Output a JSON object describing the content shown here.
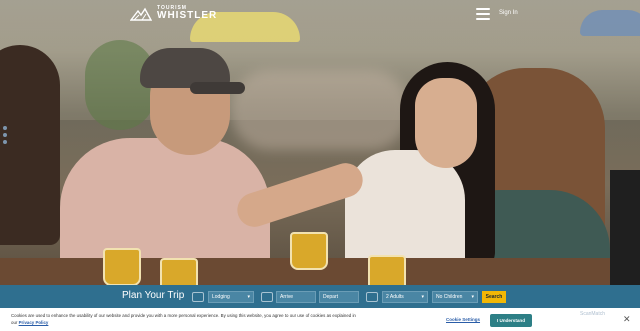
{
  "header": {
    "logo_small": "TOURISM",
    "logo_big": "WHISTLER",
    "menu_icon": "hamburger-icon",
    "signin_label": "Sign In"
  },
  "plan": {
    "title": "Plan Your Trip",
    "lodging": "Lodging",
    "arrive": "Arrive",
    "depart": "Depart",
    "adults": "2 Adults",
    "children": "No Children",
    "search_label": "Search"
  },
  "cookie": {
    "text": "Cookies are used to enhance the usability of our website and provide you with a more personal experience. By using this website, you agree to our use of cookies as explained in our",
    "policy_link": "Privacy Policy",
    "settings_label": "Cookie Settings",
    "understand_label": "I Understand",
    "close_label": "✕"
  },
  "badge": "ScanMatch",
  "colors": {
    "plan_bar": "#2f6f8f",
    "search_button": "#f2b705",
    "understand_button": "#2d7f86",
    "link": "#2a5da8"
  }
}
